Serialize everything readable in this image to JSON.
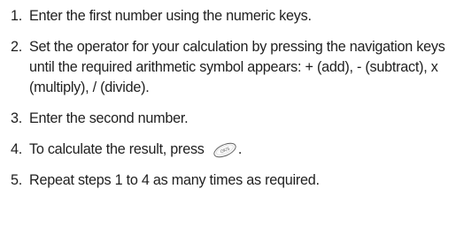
{
  "steps": [
    {
      "number": "1.",
      "text": "Enter the first number using the numeric keys."
    },
    {
      "number": "2.",
      "text": "Set the operator for your calculation by pressing the navigation keys until the required arithmetic symbol appears: + (add), - (subtract), x (multiply), / (divide)."
    },
    {
      "number": "3.",
      "text": "Enter the second number."
    },
    {
      "number": "4.",
      "text": "To calculate the result, press",
      "after": ".",
      "icon": "ok-key-icon",
      "icon_label": "OK/$"
    },
    {
      "number": "5.",
      "text": "Repeat steps 1 to 4 as many times as required."
    }
  ]
}
